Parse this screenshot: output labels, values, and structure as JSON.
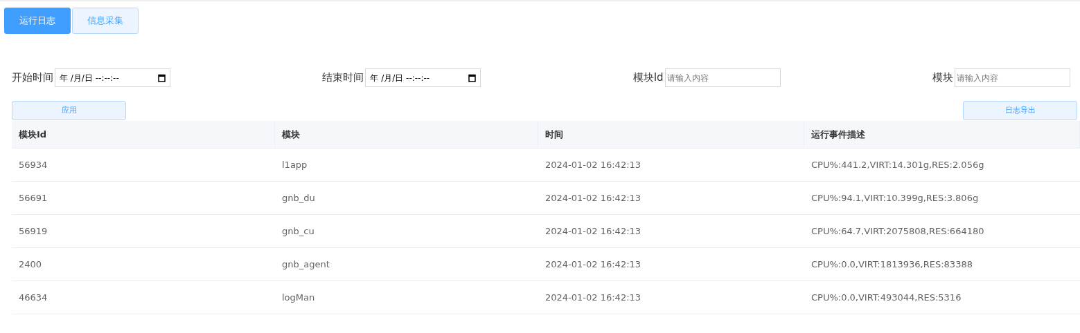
{
  "tabs": [
    {
      "label": "运行日志",
      "selected": true
    },
    {
      "label": "信息采集",
      "selected": false
    }
  ],
  "filters": [
    {
      "kind": "datetime",
      "label": "开始时间",
      "value": "年 /月/日 --:--:--"
    },
    {
      "kind": "datetime",
      "label": "结束时间",
      "value": "年 /月/日 --:--:--"
    },
    {
      "kind": "text",
      "label": "模块Id",
      "placeholder": "请输入内容"
    },
    {
      "kind": "text",
      "label": "模块",
      "placeholder": "请输入内容"
    }
  ],
  "apply_button": "应用",
  "export_button": "日志导出",
  "table": {
    "columns": [
      "模块Id",
      "模块",
      "时间",
      "运行事件描述"
    ],
    "rows": [
      [
        "56934",
        "l1app",
        "2024-01-02 16:42:13",
        "CPU%:441.2,VIRT:14.301g,RES:2.056g"
      ],
      [
        "56691",
        "gnb_du",
        "2024-01-02 16:42:13",
        "CPU%:94.1,VIRT:10.399g,RES:3.806g"
      ],
      [
        "56919",
        "gnb_cu",
        "2024-01-02 16:42:13",
        "CPU%:64.7,VIRT:2075808,RES:664180"
      ],
      [
        "2400",
        "gnb_agent",
        "2024-01-02 16:42:13",
        "CPU%:0.0,VIRT:1813936,RES:83388"
      ],
      [
        "46634",
        "logMan",
        "2024-01-02 16:42:13",
        "CPU%:0.0,VIRT:493044,RES:5316"
      ]
    ]
  }
}
